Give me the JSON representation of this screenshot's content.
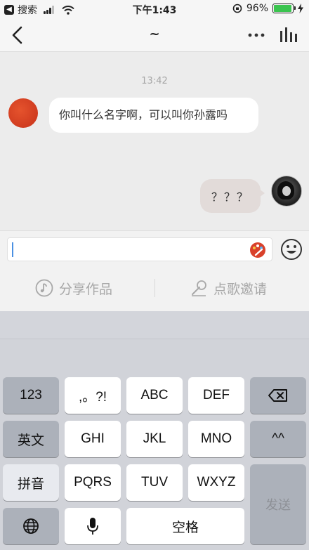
{
  "status_bar": {
    "back_app": "搜索",
    "time": "下午1:43",
    "battery": "96%",
    "battery_level": 0.96
  },
  "navbar": {
    "title": "~"
  },
  "chat": {
    "time_label": "13:42",
    "messages": [
      {
        "side": "left",
        "text": "你叫什么名字啊，可以叫你孙露吗"
      },
      {
        "side": "right",
        "text": "？？？"
      }
    ]
  },
  "actions": {
    "share": "分享作品",
    "invite": "点歌邀请"
  },
  "keyboard": {
    "row1": [
      "123",
      ",。?!",
      "ABC",
      "DEF"
    ],
    "row2": [
      "英文",
      "GHI",
      "JKL",
      "MNO",
      "^^"
    ],
    "row3": [
      "拼音",
      "PQRS",
      "TUV",
      "WXYZ"
    ],
    "space": "空格",
    "send": "发送"
  },
  "icons": {
    "back": "chevron-left-icon",
    "more": "more-dots-icon",
    "chart": "bar-chart-icon",
    "emoji": "smiley-icon",
    "palette": "palette-icon",
    "backspace": "backspace-icon",
    "globe": "globe-icon",
    "mic": "microphone-icon"
  },
  "colors": {
    "battery_green": "#3ac44f",
    "caret_blue": "#4a90e2",
    "avatar_red": "#d63d20"
  }
}
